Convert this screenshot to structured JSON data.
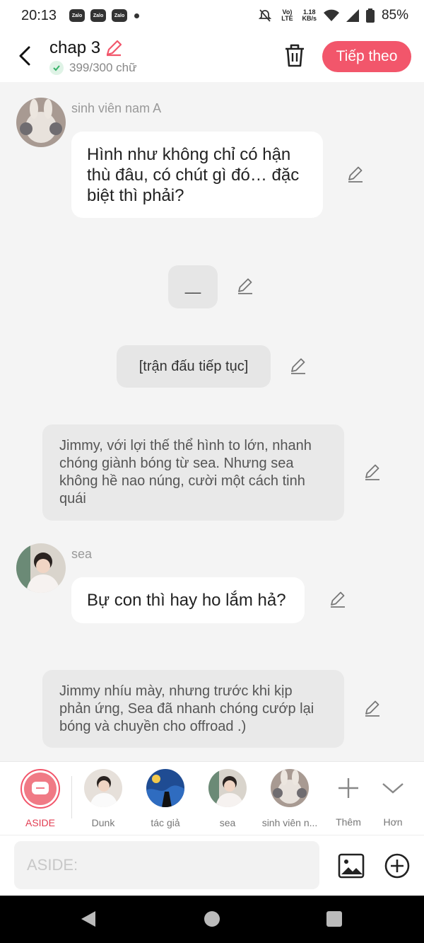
{
  "status_bar": {
    "time": "20:13",
    "zalo_label": "Zalo",
    "network_label": "Vo) LTE",
    "speed": "1.18",
    "speed_unit": "KB/s",
    "battery": "85%"
  },
  "header": {
    "title": "chap 3",
    "word_count": "399/300 chữ",
    "next_button": "Tiếp theo"
  },
  "messages": [
    {
      "type": "character",
      "sender": "sinh viên nam A",
      "text": "Hình như không chỉ có hận thù đâu, có chút gì đó… đặc biệt thì phải?"
    },
    {
      "type": "center",
      "text": "__"
    },
    {
      "type": "center",
      "text": "[trận đấu tiếp tục]"
    },
    {
      "type": "narration",
      "text": "Jimmy, với lợi thế thể hình to lớn, nhanh chóng giành bóng từ sea. Nhưng sea không hề nao núng, cười một cách tinh quái"
    },
    {
      "type": "character",
      "sender": "sea",
      "text": "Bự con thì hay ho lắm hả?"
    },
    {
      "type": "narration",
      "text": "Jimmy nhíu mày, nhưng trước khi kịp phản ứng, Sea đã nhanh chóng cướp lại bóng và chuyền cho offroad .)"
    }
  ],
  "characters": [
    {
      "label": "ASIDE",
      "selected": true
    },
    {
      "label": "Dunk"
    },
    {
      "label": "tác giả"
    },
    {
      "label": "sea"
    },
    {
      "label": "sinh viên n..."
    }
  ],
  "more_add_label": "Thêm",
  "more_expand_label": "Hơn",
  "input": {
    "placeholder": "ASIDE:",
    "value": ""
  },
  "colors": {
    "accent": "#f2566b",
    "bubble": "#ffffff",
    "narration": "#e9e9e9",
    "background": "#f4f4f4"
  }
}
